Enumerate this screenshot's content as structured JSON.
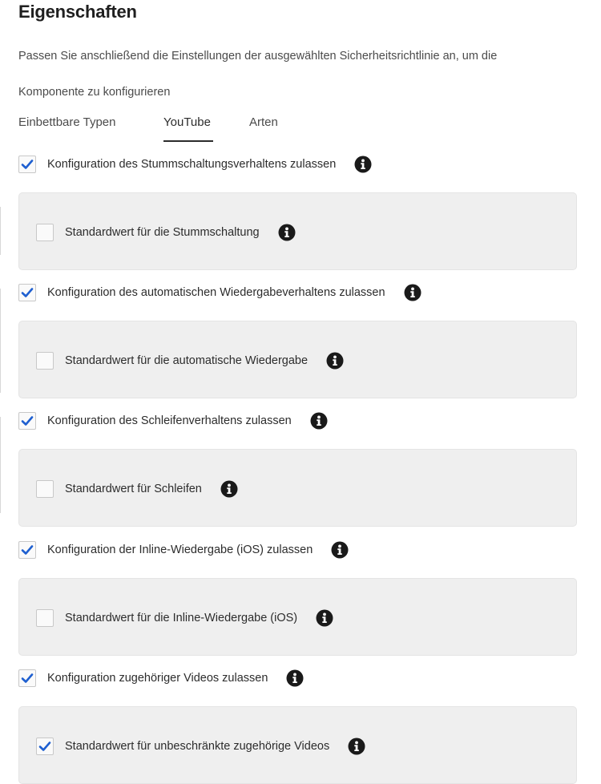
{
  "header": {
    "title": "Eigenschaften",
    "description_line1": "Passen Sie anschließend die Einstellungen der ausgewählten Sicherheitsrichtlinie an, um die",
    "description_line2": "Komponente zu konfigurieren"
  },
  "tabs": [
    {
      "label": "Einbettbare Typen",
      "selected": false
    },
    {
      "label": "YouTube",
      "selected": true
    },
    {
      "label": "Arten",
      "selected": false
    }
  ],
  "colors": {
    "checkmark": "#1e5fd0",
    "panel_bg": "#efefef",
    "info_icon": "#1a1a1a"
  },
  "settings": [
    {
      "allow": {
        "label": "Konfiguration des Stummschaltungsverhaltens zulassen",
        "checked": true,
        "icon": "info-icon"
      },
      "default": {
        "label": "Standardwert für die Stummschaltung",
        "checked": false,
        "icon": "info-icon"
      }
    },
    {
      "allow": {
        "label": "Konfiguration des automatischen Wiedergabeverhaltens zulassen",
        "checked": true,
        "icon": "info-icon"
      },
      "default": {
        "label": "Standardwert für die automatische Wiedergabe",
        "checked": false,
        "icon": "info-icon"
      }
    },
    {
      "allow": {
        "label": "Konfiguration des Schleifenverhaltens zulassen",
        "checked": true,
        "icon": "info-icon"
      },
      "default": {
        "label": "Standardwert für Schleifen",
        "checked": false,
        "icon": "info-icon"
      }
    },
    {
      "allow": {
        "label": "Konfiguration der Inline-Wiedergabe (iOS) zulassen",
        "checked": true,
        "icon": "info-icon"
      },
      "default": {
        "label": "Standardwert für die Inline-Wiedergabe (iOS)",
        "checked": false,
        "icon": "info-icon"
      }
    },
    {
      "allow": {
        "label": "Konfiguration zugehöriger Videos zulassen",
        "checked": true,
        "icon": "info-icon"
      },
      "default": {
        "label": "Standardwert für unbeschränkte zugehörige Videos",
        "checked": true,
        "icon": "info-icon"
      }
    }
  ]
}
